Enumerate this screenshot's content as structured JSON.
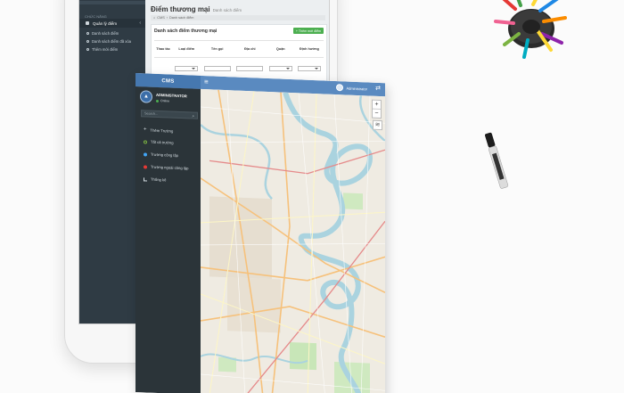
{
  "tablet": {
    "page_title": "Điểm thương mại",
    "page_subtitle": "Danh sách điểm",
    "breadcrumb": [
      "CMS",
      "Danh sách điểm"
    ],
    "sidebar": {
      "section_label": "CHỨC NĂNG",
      "menu_main": "Quản lý điểm",
      "items": [
        "Danh sách điểm",
        "Danh sách điểm đã xóa",
        "Thêm mới điểm"
      ]
    },
    "panel_title": "Danh sách điểm thương mại",
    "add_button": "+ Thêm mới điểm",
    "table_headers": [
      "Thao tác",
      "Loại điểm",
      "Tên gọi",
      "Địa chỉ",
      "Quận",
      "Định hướng"
    ]
  },
  "cms": {
    "brand": "CMS",
    "topbar_user": "Administrator",
    "profile_name": "ADMINISTRATOR",
    "profile_status": "Online",
    "search_placeholder": "Search...",
    "menu": [
      {
        "label": "Thêm Trường",
        "icon": "plus-icon"
      },
      {
        "label": "Tất cả trường",
        "icon": "circle-icon"
      },
      {
        "label": "Trường công lập",
        "icon": "dot-blue-icon"
      },
      {
        "label": "Trường ngoài công lập",
        "icon": "dot-red-icon"
      },
      {
        "label": "Thống kê",
        "icon": "bar-chart-icon"
      }
    ],
    "map_zoom_in": "+",
    "map_zoom_out": "−"
  },
  "colors": {
    "topbar": "#5a8ac0",
    "brand": "#4678b0",
    "sidebar": "#2b3439",
    "map_water": "#aad3df",
    "map_park": "#c8e6b8",
    "add_button": "#4caf50"
  }
}
